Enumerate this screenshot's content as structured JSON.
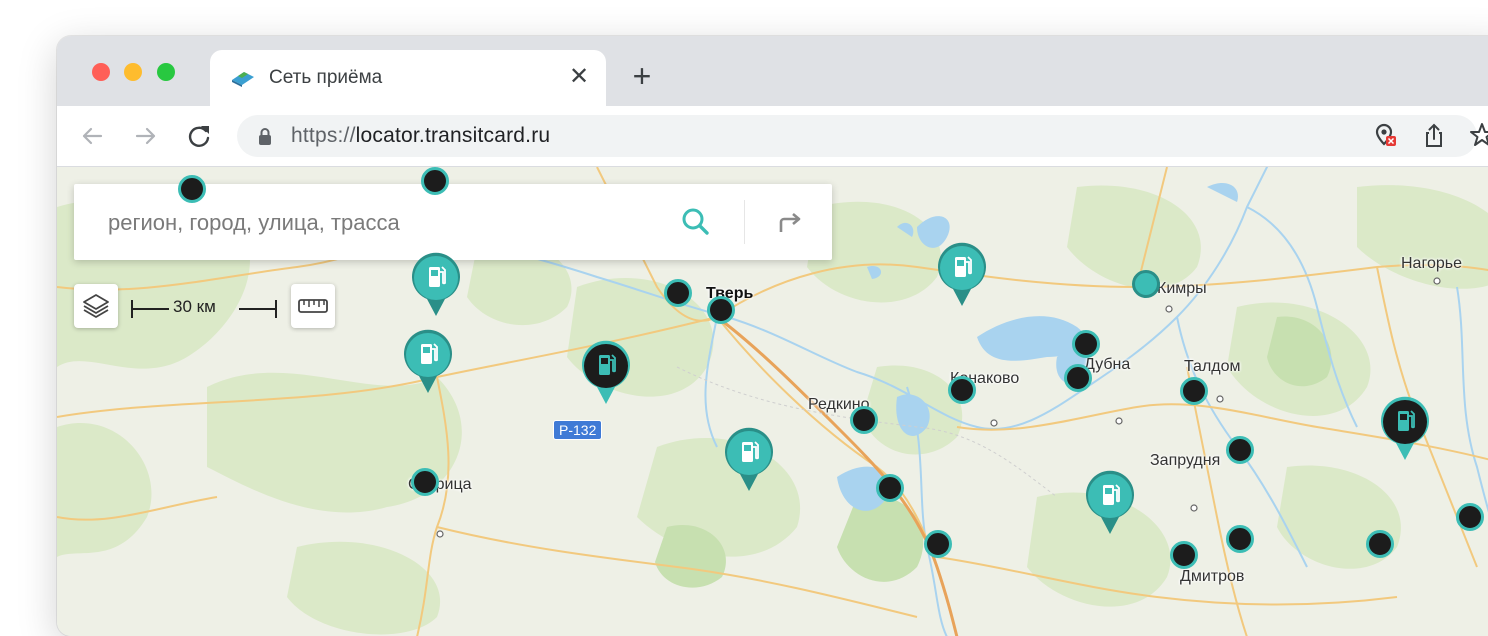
{
  "browser": {
    "tab": {
      "title": "Сеть приёма",
      "close_label": "✕"
    },
    "new_tab_label": "+",
    "address": {
      "scheme": "https://",
      "host": "locator.transitcard.ru"
    }
  },
  "map": {
    "search": {
      "placeholder": "регион, город, улица, трасса"
    },
    "scale_label": "30 км",
    "road_shield": "Р-132",
    "cities": [
      "Тверь",
      "Нагорье",
      "Кимры",
      "Талдом",
      "Конаково",
      "Дубна",
      "Редкино",
      "Запрудня",
      "Старица",
      "Дмитров"
    ],
    "colors": {
      "accent": "#3cbdb5",
      "marker_dark": "#1c1c1c",
      "water": "#a9d3ef",
      "road": "#f2c97e"
    }
  }
}
